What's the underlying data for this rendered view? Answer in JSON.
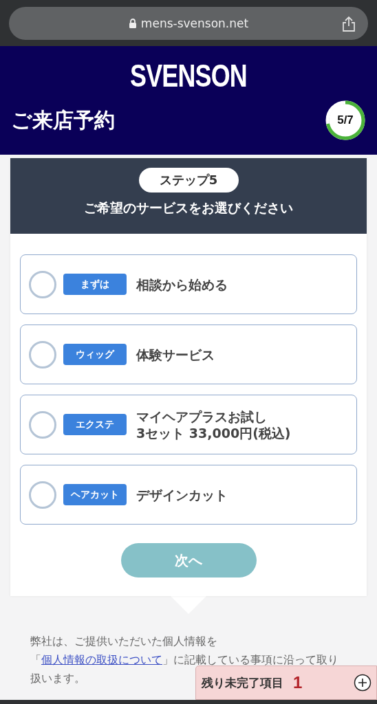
{
  "browser": {
    "url": "mens-svenson.net"
  },
  "header": {
    "logo": "SVENSON",
    "title": "ご来店予約",
    "progress": {
      "label": "5/7",
      "level": 0.714
    }
  },
  "step": {
    "badge": "ステップ5",
    "heading": "ご希望のサービスをお選びください"
  },
  "options": [
    {
      "tag": "まずは",
      "lines": [
        "相談から始める"
      ],
      "selected": false
    },
    {
      "tag": "ウィッグ",
      "lines": [
        "体験サービス"
      ],
      "selected": false
    },
    {
      "tag": "エクステ",
      "lines": [
        "マイヘアプラスお試し",
        "3セット 33,000円(税込)"
      ],
      "selected": false
    },
    {
      "tag": "ヘアカット",
      "lines": [
        "デザインカット"
      ],
      "selected": false
    }
  ],
  "next_button": {
    "label": "次へ",
    "disabled": true
  },
  "notice": {
    "before": "弊社は、ご提供いただいた個人情報を「",
    "link": "個人情報の取扱について",
    "after": "」に記載している事項に沿って取り扱います。"
  },
  "remaining": {
    "label": "残り未完了項目",
    "count": "1"
  }
}
